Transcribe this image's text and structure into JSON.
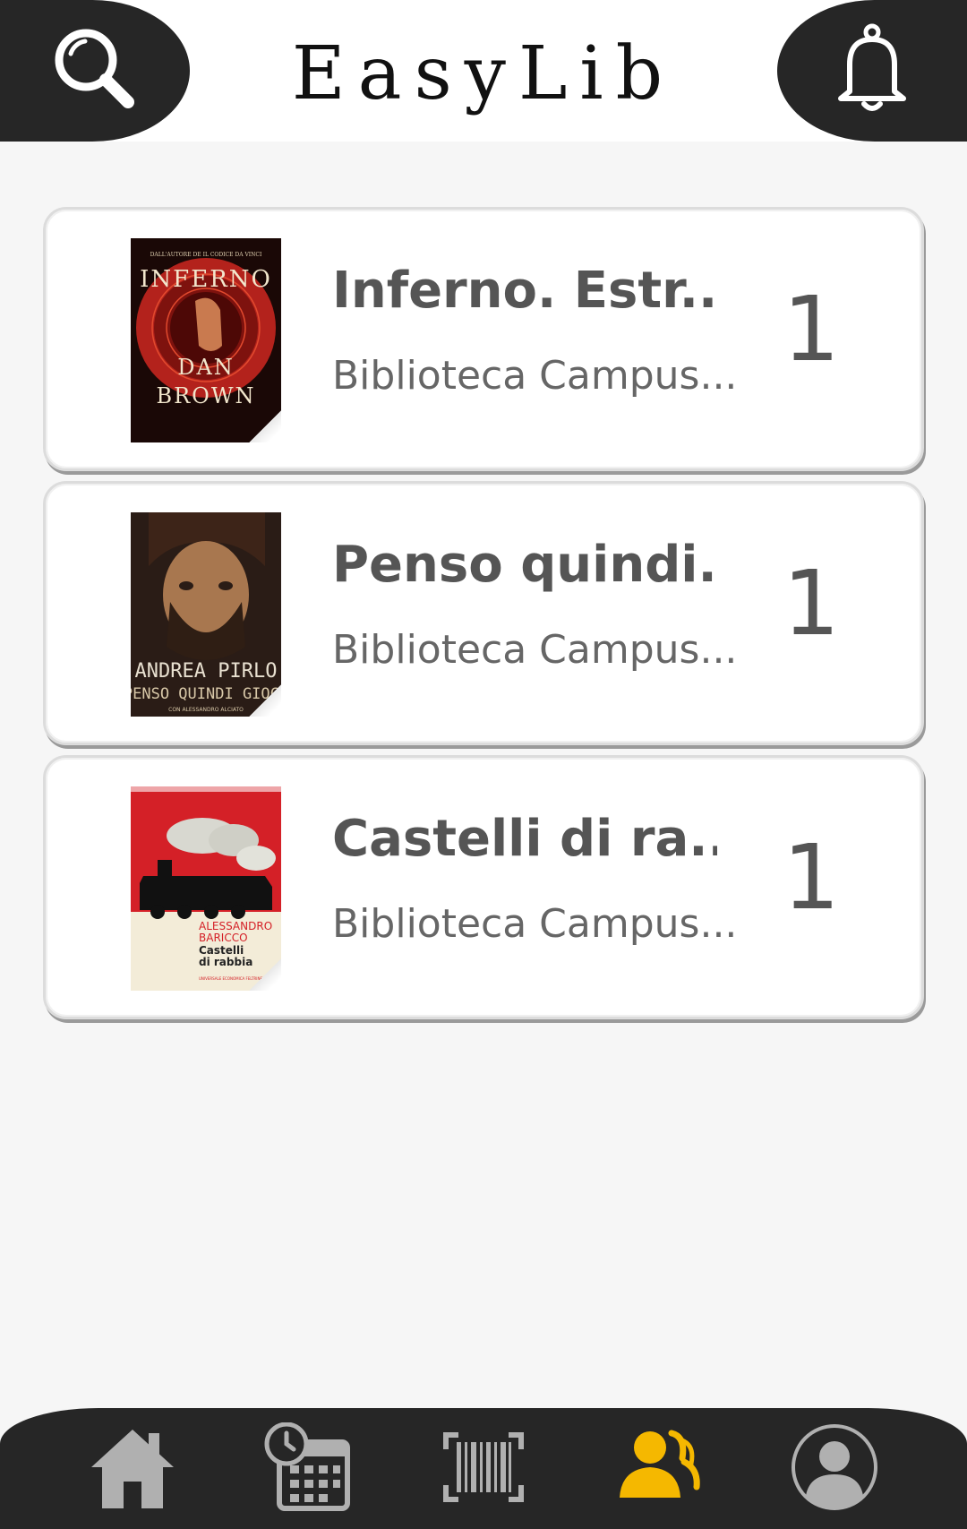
{
  "header": {
    "title": "EasyLib",
    "search_icon": "search-icon",
    "notification_icon": "bell-icon"
  },
  "books": [
    {
      "title": "Inferno. Estr...",
      "library": "Biblioteca Campus...",
      "count": "1",
      "cover": {
        "top_line": "DALL'AUTORE DE IL CODICE DA VINCI",
        "title": "INFERNO",
        "author_first": "DAN",
        "author_last": "BROWN",
        "color": "#b3221c"
      }
    },
    {
      "title": "Penso quindi...",
      "library": "Biblioteca Campus...",
      "count": "1",
      "cover": {
        "author": "ANDREA PIRLO",
        "title": "PENSO QUINDI GIOCO",
        "coauthor": "CON ALESSANDRO ALCIATO",
        "color": "#3a2a22"
      }
    },
    {
      "title": "Castelli di ra...",
      "library": "Biblioteca Campus...",
      "count": "1",
      "cover": {
        "author_first": "ALESSANDRO",
        "author_last": "BARICCO",
        "title_line1": "Castelli",
        "title_line2": "di rabbia",
        "publisher": "UNIVERSALE ECONOMICA FELTRINELLI",
        "color": "#d42027"
      }
    }
  ],
  "bottom_nav": {
    "items": [
      {
        "icon": "home-icon",
        "active": false
      },
      {
        "icon": "calendar-clock-icon",
        "active": false
      },
      {
        "icon": "barcode-scan-icon",
        "active": false
      },
      {
        "icon": "group-icon",
        "active": true
      },
      {
        "icon": "profile-icon",
        "active": false
      }
    ],
    "active_color": "#f5b800",
    "inactive_color": "#b0b0b0"
  }
}
